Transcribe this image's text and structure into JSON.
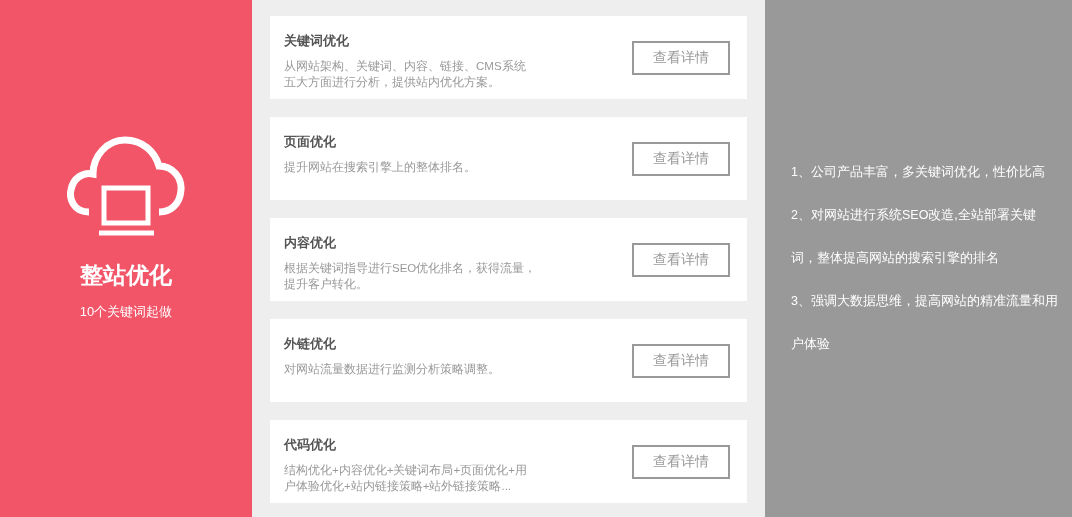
{
  "feature": {
    "title": "整站优化",
    "subtitle": "10个关键词起做"
  },
  "services": [
    {
      "title": "关键词优化",
      "description": [
        "从网站架构、关键词、内容、链接、CMS系统",
        "五大方面进行分析，提供站内优化方案。"
      ],
      "button": "查看详情"
    },
    {
      "title": "页面优化",
      "description": [
        "提升网站在搜索引擎上的整体排名。"
      ],
      "button": "查看详情"
    },
    {
      "title": "内容优化",
      "description": [
        "根据关键词指导进行SEO优化排名，获得流量，",
        "提升客户转化。"
      ],
      "button": "查看详情"
    },
    {
      "title": "外链优化",
      "description": [
        "对网站流量数据进行监测分析策略调整。"
      ],
      "button": "查看详情"
    },
    {
      "title": "代码优化",
      "description": [
        "结构优化+内容优化+关键词布局+页面优化+用",
        "户体验优化+站内链接策略+站外链接策略..."
      ],
      "button": "查看详情"
    }
  ],
  "advantages": [
    {
      "lines": [
        "1、公司产品丰富，多关键词优化，性价比高"
      ]
    },
    {
      "lines": [
        "2、对网站进行系统SEO改造,全站部署关键",
        "词，整体提高网站的搜索引擎的排名"
      ]
    },
    {
      "lines": [
        "3、强调大数据思维，提高网站的精准流量和用",
        "户体验"
      ]
    }
  ]
}
